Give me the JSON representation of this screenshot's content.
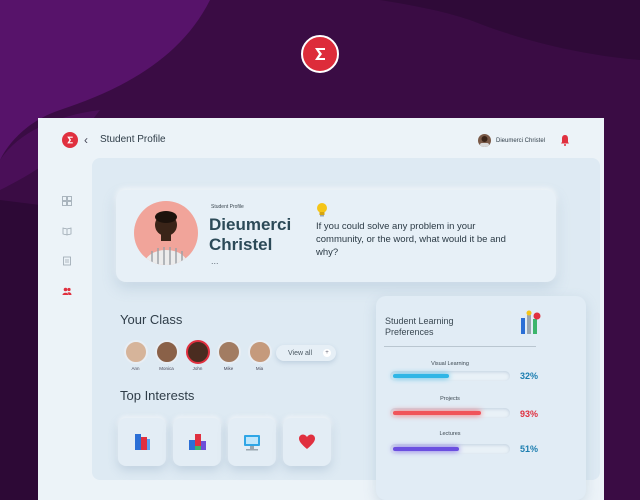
{
  "header": {
    "back_glyph": "‹",
    "title": "Student Profile",
    "user_name": "Dieumerci Christel"
  },
  "profile": {
    "label": "Student Profile",
    "name": "Dieumerci Christel",
    "more": "...",
    "question": "If you could solve any problem in your community, or the word, what would it be and why?"
  },
  "your_class": {
    "title": "Your Class",
    "students": [
      "Ann",
      "Monica",
      "John",
      "Mike",
      "Mia"
    ],
    "view_all_label": "View all",
    "view_all_icon": "+"
  },
  "top_interests": {
    "title": "Top Interests",
    "icons": [
      "books-icon",
      "blocks-icon",
      "computer-icon",
      "heart-icon"
    ]
  },
  "learning_preferences": {
    "title": "Student Learning Preferences",
    "items": [
      {
        "label": "Visual Learning",
        "value": "32%",
        "fraction": 0.32,
        "color": "#2fb6e6",
        "value_color": "#1c7eb0"
      },
      {
        "label": "Projects",
        "value": "93%",
        "fraction": 0.93,
        "color": "#f0545a",
        "value_color": "#e0303f"
      },
      {
        "label": "Lectures",
        "value": "51%",
        "fraction": 0.51,
        "color": "#6b4fe0",
        "value_color": "#1c7eb0"
      }
    ]
  },
  "colors": {
    "brand": "#e0303f",
    "background_purple": "#3a0c44"
  }
}
